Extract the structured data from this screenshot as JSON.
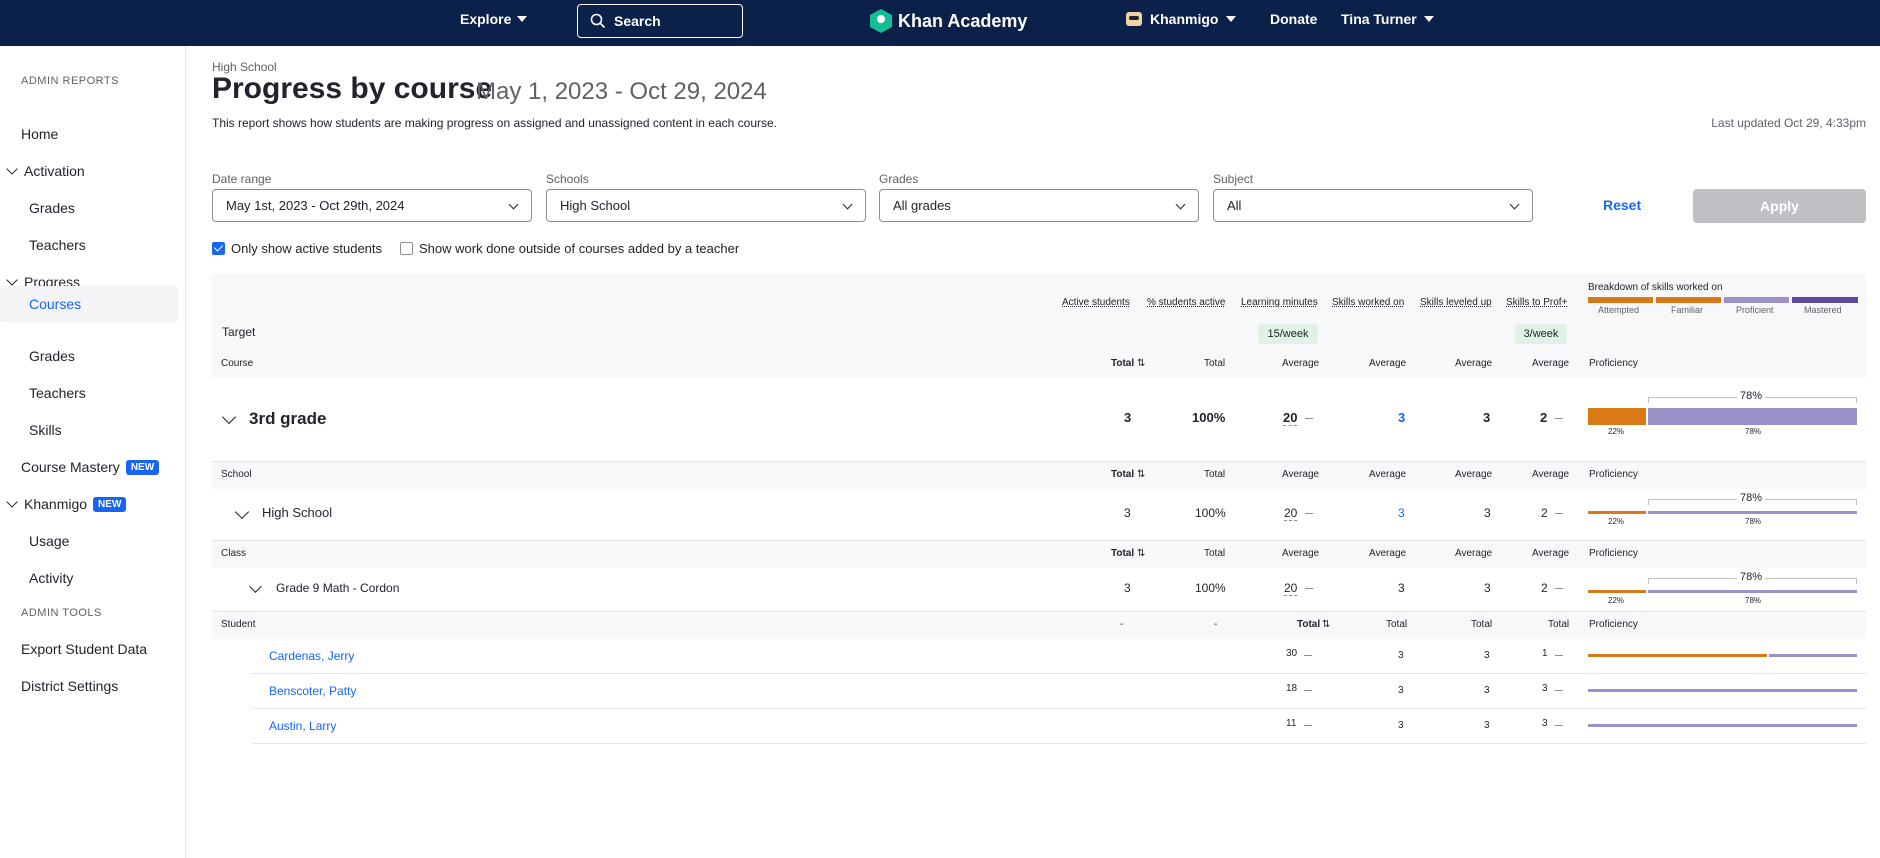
{
  "nav": {
    "explore": "Explore",
    "search": "Search",
    "brand": "Khan Academy",
    "khanmigo": "Khanmigo",
    "donate": "Donate",
    "user": "Tina Turner"
  },
  "sidebar": {
    "section1": "ADMIN REPORTS",
    "home": "Home",
    "activation": "Activation",
    "activation_grades": "Grades",
    "activation_teachers": "Teachers",
    "progress": "Progress",
    "courses": "Courses",
    "progress_grades": "Grades",
    "progress_teachers": "Teachers",
    "skills": "Skills",
    "course_mastery": "Course Mastery",
    "khanmigo": "Khanmigo",
    "new_badge": "NEW",
    "usage": "Usage",
    "activity": "Activity",
    "section2": "ADMIN TOOLS",
    "export": "Export Student Data",
    "district": "District Settings"
  },
  "header": {
    "breadcrumb": "High School",
    "title": "Progress by course",
    "date_range": "May 1, 2023 - Oct 29, 2024",
    "description": "This report shows how students are making progress on assigned and unassigned content in each course.",
    "last_updated": "Last updated Oct 29, 4:33pm"
  },
  "filters": {
    "date_label": "Date range",
    "date_value": "May 1st, 2023 - Oct 29th, 2024",
    "schools_label": "Schools",
    "schools_value": "High School",
    "grades_label": "Grades",
    "grades_value": "All grades",
    "subject_label": "Subject",
    "subject_value": "All",
    "reset": "Reset",
    "apply": "Apply",
    "active_only": "Only show active students",
    "outside_work": "Show work done outside of courses added by a teacher"
  },
  "table": {
    "col_active": "Active students",
    "col_pct_active": "% students active",
    "col_minutes": "Learning minutes",
    "col_worked": "Skills worked on",
    "col_leveled": "Skills leveled up",
    "col_prof": "Skills to Prof+",
    "breakdown_title": "Breakdown of skills worked on",
    "legend": [
      "Attempted",
      "Familiar",
      "Proficient",
      "Mastered"
    ],
    "legend_colors": [
      "#d97a16",
      "#d97a16",
      "#9b90c8",
      "#5b4a9b"
    ],
    "target_label": "Target",
    "target_minutes": "15/week",
    "target_prof": "3/week",
    "sub": {
      "total": "Total",
      "average": "Average",
      "proficiency": "Proficiency",
      "dash": "-"
    },
    "course_label": "Course",
    "school_label": "School",
    "class_label": "Class",
    "student_label": "Student",
    "course_row": {
      "name": "3rd grade",
      "active": "3",
      "pct": "100%",
      "minutes": "20",
      "worked": "3",
      "leveled": "3",
      "prof": "2",
      "attempted": "22%",
      "proficient": "78%",
      "bracket": "78%"
    },
    "school_row": {
      "name": "High School",
      "active": "3",
      "pct": "100%",
      "minutes": "20",
      "worked": "3",
      "leveled": "3",
      "prof": "2",
      "attempted": "22%",
      "proficient": "78%",
      "bracket": "78%"
    },
    "class_row": {
      "name": "Grade 9 Math - Cordon",
      "active": "3",
      "pct": "100%",
      "minutes": "20",
      "worked": "3",
      "leveled": "3",
      "prof": "2",
      "attempted": "22%",
      "proficient": "78%",
      "bracket": "78%"
    },
    "students": [
      {
        "name": "Cardenas, Jerry",
        "minutes": "30",
        "worked": "3",
        "leveled": "3",
        "prof": "1"
      },
      {
        "name": "Benscoter, Patty",
        "minutes": "18",
        "worked": "3",
        "leveled": "3",
        "prof": "3"
      },
      {
        "name": "Austin, Larry",
        "minutes": "11",
        "worked": "3",
        "leveled": "3",
        "prof": "3"
      }
    ]
  }
}
